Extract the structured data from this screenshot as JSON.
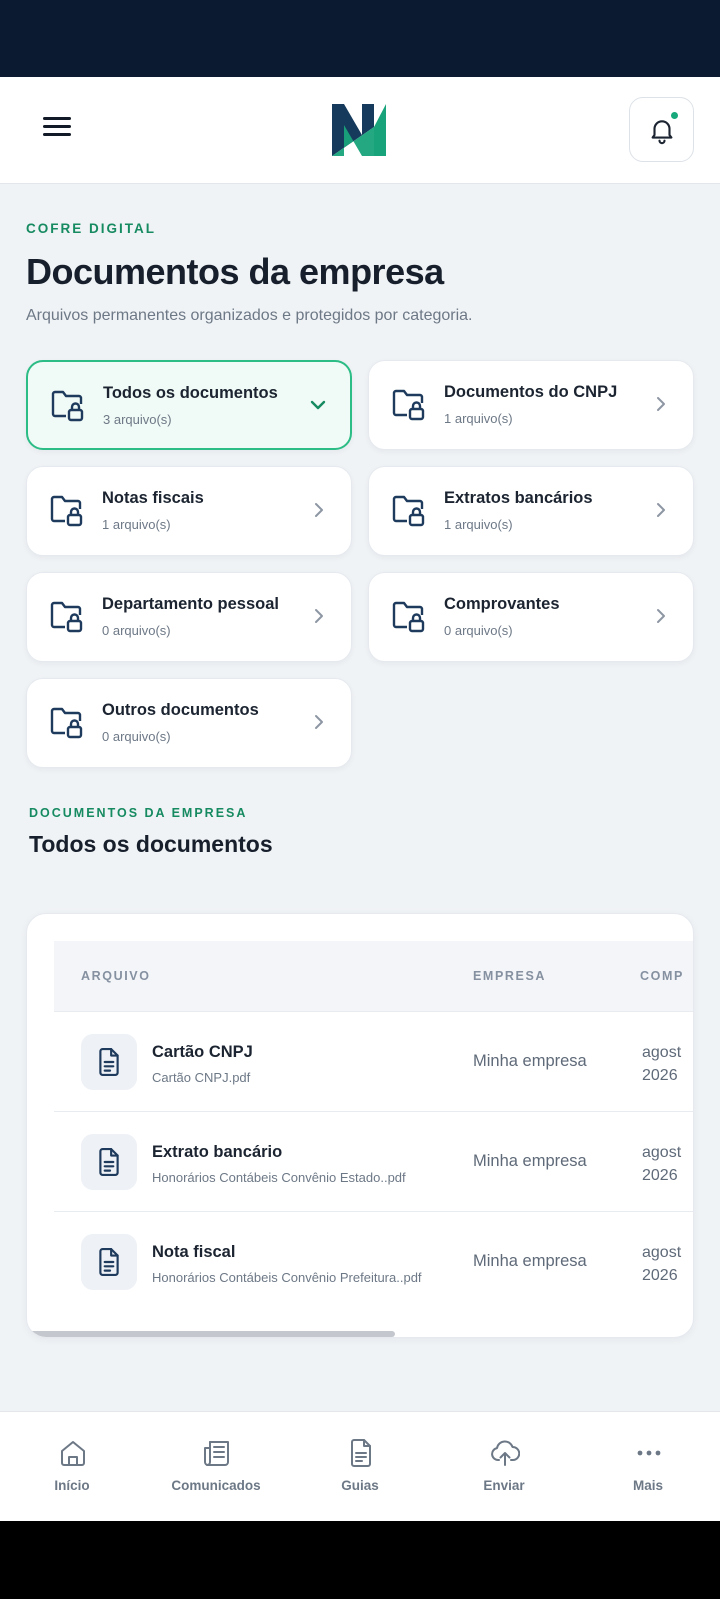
{
  "header": {
    "menu_icon": "hamburger-menu-icon",
    "logo_icon": "n-logo",
    "notification_icon": "bell-icon",
    "brand_colors": {
      "navy": "#153a5b",
      "green": "#18a37a"
    }
  },
  "page": {
    "eyebrow": "COFRE DIGITAL",
    "title": "Documentos da empresa",
    "subtitle": "Arquivos permanentes organizados e protegidos por categoria."
  },
  "categories": [
    {
      "name": "Todos os documentos",
      "count": "3 arquivo(s)",
      "active": true
    },
    {
      "name": "Documentos do CNPJ",
      "count": "1 arquivo(s)",
      "active": false
    },
    {
      "name": "Notas fiscais",
      "count": "1 arquivo(s)",
      "active": false
    },
    {
      "name": "Extratos bancários",
      "count": "1 arquivo(s)",
      "active": false
    },
    {
      "name": "Departamento pessoal",
      "count": "0 arquivo(s)",
      "active": false
    },
    {
      "name": "Comprovantes",
      "count": "0 arquivo(s)",
      "active": false
    },
    {
      "name": "Outros documentos",
      "count": "0 arquivo(s)",
      "active": false
    }
  ],
  "documents_section": {
    "eyebrow": "DOCUMENTOS DA EMPRESA",
    "title": "Todos os documentos",
    "columns": [
      "ARQUIVO",
      "EMPRESA",
      "COMP"
    ],
    "rows": [
      {
        "title": "Cartão CNPJ",
        "file": "Cartão CNPJ.pdf",
        "company": "Minha empresa",
        "comp_line1": "agost",
        "comp_line2": "2026"
      },
      {
        "title": "Extrato bancário",
        "file": "Honorários Contábeis Convênio Estado..pdf",
        "company": "Minha empresa",
        "comp_line1": "agost",
        "comp_line2": "2026"
      },
      {
        "title": "Nota fiscal",
        "file": "Honorários Contábeis Convênio Prefeitura..pdf",
        "company": "Minha empresa",
        "comp_line1": "agost",
        "comp_line2": "2026"
      }
    ]
  },
  "bottom_nav": [
    {
      "label": "Início",
      "icon": "home-icon"
    },
    {
      "label": "Comunicados",
      "icon": "newspaper-icon"
    },
    {
      "label": "Guias",
      "icon": "document-icon"
    },
    {
      "label": "Enviar",
      "icon": "cloud-upload-icon"
    },
    {
      "label": "Mais",
      "icon": "more-dots-icon"
    }
  ],
  "colors": {
    "accent_green": "#168a60",
    "active_border": "#2cbc86",
    "active_bg": "#f0faf6",
    "icon_navy": "#1e3a5c"
  }
}
